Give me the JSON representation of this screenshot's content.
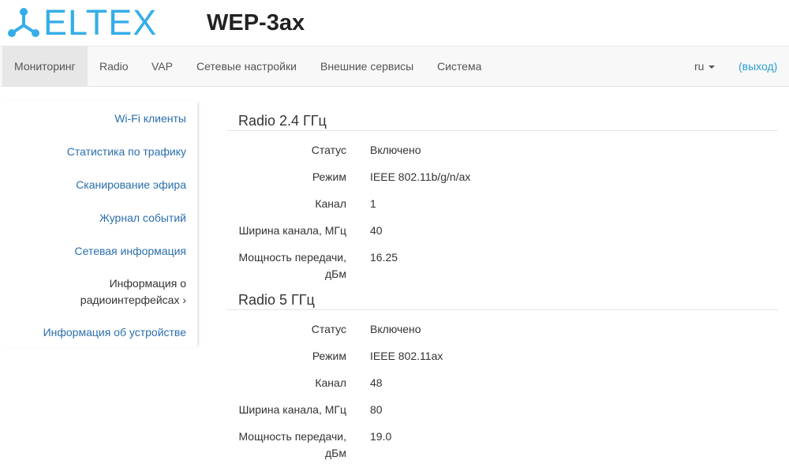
{
  "header": {
    "logo_text": "ELTEX",
    "device_title": "WEP-3ax"
  },
  "navbar": {
    "items": [
      {
        "label": "Мониторинг",
        "active": true
      },
      {
        "label": "Radio"
      },
      {
        "label": "VAP"
      },
      {
        "label": "Сетевые настройки"
      },
      {
        "label": "Внешние сервисы"
      },
      {
        "label": "Система"
      }
    ],
    "language": "ru",
    "logout": "(выход)"
  },
  "sidebar": {
    "items": [
      {
        "label": "Wi-Fi клиенты"
      },
      {
        "label": "Статистика по трафику"
      },
      {
        "label": "Сканирование эфира"
      },
      {
        "label": "Журнал событий"
      },
      {
        "label": "Сетевая информация"
      },
      {
        "label_line1": "Информация о",
        "label_line2": "радиоинтерфейсах ›",
        "active": true
      },
      {
        "label": "Информация об устройстве"
      }
    ]
  },
  "radio24": {
    "title": "Radio 2.4 ГГц",
    "rows": [
      {
        "label": "Статус",
        "value": "Включено"
      },
      {
        "label": "Режим",
        "value": "IEEE 802.11b/g/n/ax"
      },
      {
        "label": "Канал",
        "value": "1"
      },
      {
        "label": "Ширина канала, МГц",
        "value": "40"
      },
      {
        "label_line1": "Мощность передачи,",
        "label_line2": "дБм",
        "value": "16.25"
      }
    ]
  },
  "radio5": {
    "title": "Radio 5 ГГц",
    "rows": [
      {
        "label": "Статус",
        "value": "Включено"
      },
      {
        "label": "Режим",
        "value": "IEEE 802.11ax"
      },
      {
        "label": "Канал",
        "value": "48"
      },
      {
        "label": "Ширина канала, МГц",
        "value": "80"
      },
      {
        "label_line1": "Мощность передачи,",
        "label_line2": "дБм",
        "value": "19.0"
      }
    ]
  },
  "colors": {
    "brand": "#35aee8",
    "link": "#2a6fad",
    "nav_link": "#2a9fd6",
    "navbar_bg": "#f8f8f8",
    "active_bg": "#e7e7e7"
  }
}
